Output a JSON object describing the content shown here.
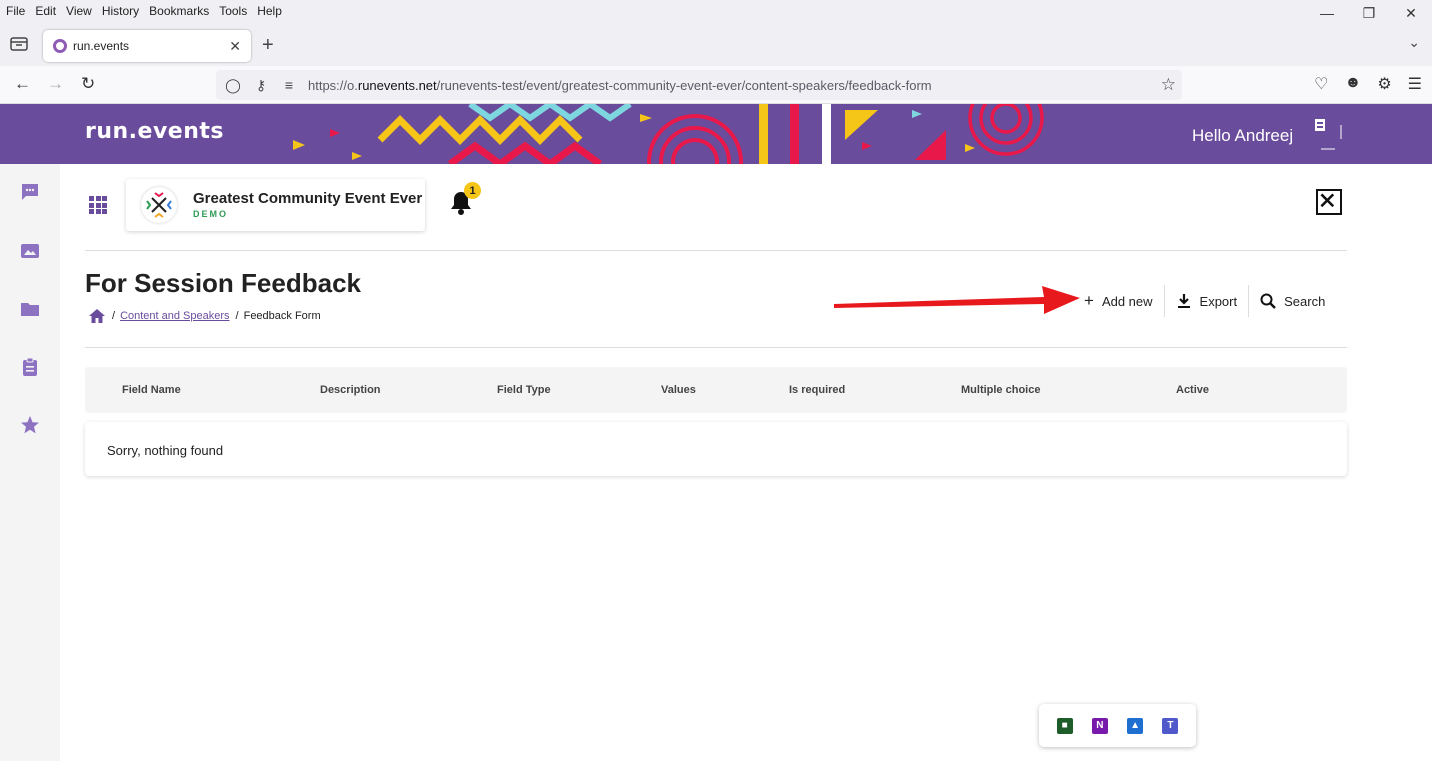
{
  "browser": {
    "menu": [
      "File",
      "Edit",
      "View",
      "History",
      "Bookmarks",
      "Tools",
      "Help"
    ],
    "tab_title": "run.events",
    "url_prefix": "https://o.",
    "url_domain": "runevents.net",
    "url_path": "/runevents-test/event/greatest-community-event-ever/content-speakers/feedback-form"
  },
  "header": {
    "logo": "run.events",
    "greeting": "Hello Andreej"
  },
  "rail": {
    "items": [
      "chat-icon",
      "image-icon",
      "folder-icon",
      "clipboard-icon",
      "star-icon"
    ]
  },
  "event": {
    "name": "Greatest Community Event Ever",
    "tag": "DEMO",
    "notification_count": "1"
  },
  "page": {
    "title": "For Session Feedback",
    "breadcrumb": {
      "section": "Content and Speakers",
      "current": "Feedback Form"
    },
    "actions": {
      "add": "Add new",
      "export": "Export",
      "search": "Search"
    }
  },
  "table": {
    "columns": [
      "Field Name",
      "Description",
      "Field Type",
      "Values",
      "Is required",
      "Multiple choice",
      "Active"
    ],
    "empty_message": "Sorry, nothing found"
  },
  "colors": {
    "brand": "#6a4c9c",
    "demo_tag": "#2e9c55",
    "badge": "#f5c518",
    "annotation_arrow": "#e8191c"
  }
}
